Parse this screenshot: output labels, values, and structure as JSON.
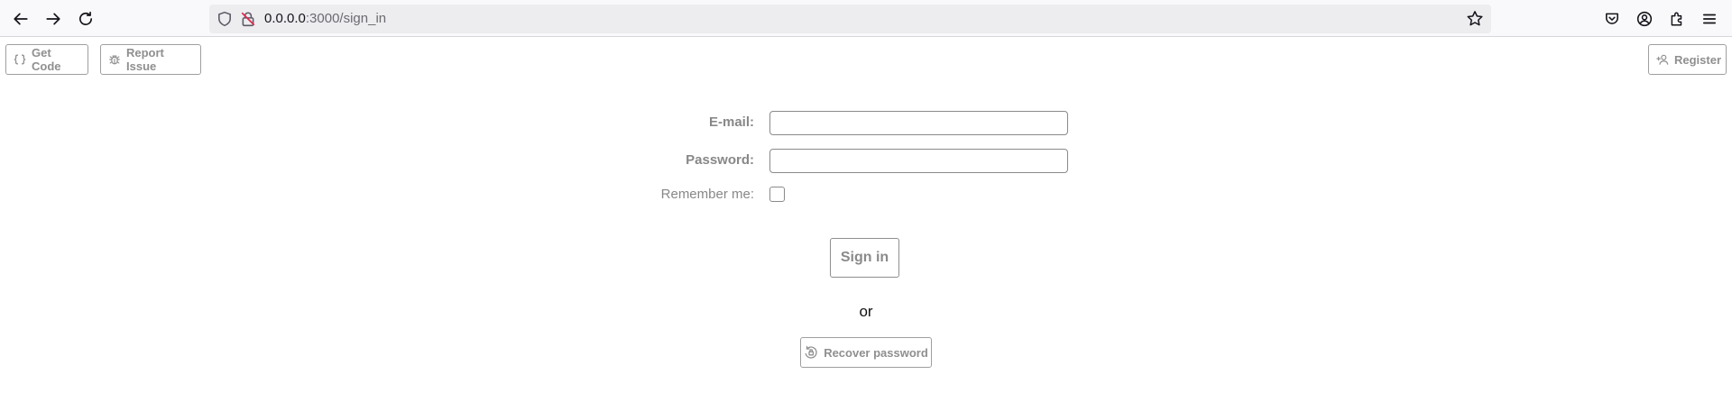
{
  "browser": {
    "url_host": "0.0.0.0",
    "url_path": ":3000/sign_in"
  },
  "toolbar": {
    "get_code_label": "Get Code",
    "report_issue_label": "Report Issue",
    "register_label": "Register"
  },
  "form": {
    "email_label": "E-mail:",
    "email_value": "",
    "password_label": "Password:",
    "password_value": "",
    "remember_label": "Remember me:",
    "remember_checked": false,
    "sign_in_label": "Sign in",
    "or_text": "or",
    "recover_label": "Recover password"
  }
}
